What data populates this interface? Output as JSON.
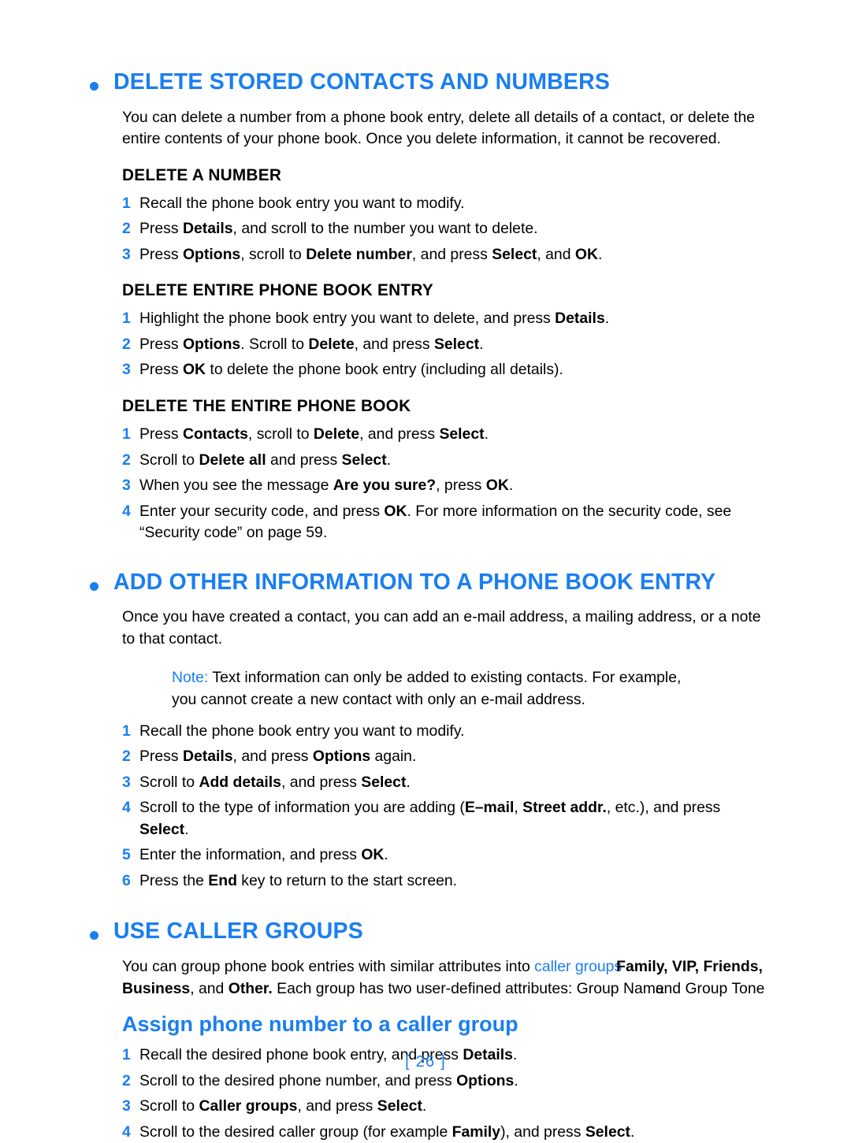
{
  "page": {
    "number_label": "[ 26 ]",
    "bullet_color": "#1a7ef0",
    "heading_color": "#1a7ef0",
    "body_color": "#000000"
  },
  "sections": [
    {
      "heading": "DELETE STORED CONTACTS AND NUMBERS",
      "intro": "You can delete a number from a phone book entry, delete all details of a contact, or delete the entire contents of your phone book. Once you delete information, it cannot be recovered.",
      "subsections": [
        {
          "heading": "DELETE A NUMBER",
          "steps": [
            {
              "num": "1",
              "text": "Recall the phone book entry you want to modify."
            },
            {
              "num": "2",
              "text": "Press Details, and scroll to the number you want to delete."
            },
            {
              "num": "3",
              "text": "Press Options, scroll to Delete number, and press Select, and OK."
            }
          ]
        },
        {
          "heading": "DELETE ENTIRE PHONE BOOK ENTRY",
          "steps": [
            {
              "num": "1",
              "text": "Highlight the phone book entry you want to delete, and press Details."
            },
            {
              "num": "2",
              "text": "Press Options. Scroll to Delete, and press Select."
            },
            {
              "num": "3",
              "text": "Press OK to delete the phone book entry (including all details)."
            }
          ]
        },
        {
          "heading": "DELETE THE ENTIRE PHONE BOOK",
          "steps": [
            {
              "num": "1",
              "text": "Press Contacts, scroll to Delete, and press Select."
            },
            {
              "num": "2",
              "text": "Scroll to Delete all and press Select."
            },
            {
              "num": "3",
              "text": "When you see the message Are you sure?, press OK."
            },
            {
              "num": "4",
              "text": "Enter your security code, and press OK. For more information on the security code, see “Security code” on page 59."
            }
          ]
        }
      ]
    },
    {
      "heading": "ADD OTHER INFORMATION TO A PHONE BOOK ENTRY",
      "intro": "Once you have created a contact, you can add an e-mail address, a mailing address, or a note to that contact.",
      "note_label": "Note:",
      "note_text": "Text information can only be added to existing contacts. For example, you cannot create a new contact with only an e-mail address.",
      "steps": [
        {
          "num": "1",
          "text": "Recall the phone book entry you want to modify."
        },
        {
          "num": "2",
          "text": "Press Details, and press Options again."
        },
        {
          "num": "3",
          "text": "Scroll to Add details, and press Select."
        },
        {
          "num": "4",
          "text": "Scroll to the type of information you are adding (E-mail, Street addr., etc.), and press Select."
        },
        {
          "num": "5",
          "text": "Enter the information, and press OK."
        },
        {
          "num": "6",
          "text": "Press the End key to return to the start screen."
        }
      ]
    },
    {
      "heading": "USE CALLER GROUPS",
      "intro_part1": "You can group phone book entries with similar attributes into ",
      "intro_link": "caller groups",
      "intro_groups": "Family, VIP, Friends,",
      "intro_groups2a": "Business",
      "intro_groups2b": ", and ",
      "intro_groups2c": "Other.",
      "intro_part3": " Each group has two user-defined attributes: ",
      "intro_attr1": "Group Name",
      "intro_attr_and": "and ",
      "intro_attr2": "Group Tone",
      "subheading": "Assign phone number to a caller group",
      "steps": [
        {
          "num": "1",
          "text": "Recall the desired phone book entry, and press Details."
        },
        {
          "num": "2",
          "text": "Scroll to the desired phone number, and press Options."
        },
        {
          "num": "3",
          "text": "Scroll to Caller groups, and press Select."
        },
        {
          "num": "4",
          "text": "Scroll to the desired caller group (for example Family), and press Select."
        }
      ]
    }
  ]
}
